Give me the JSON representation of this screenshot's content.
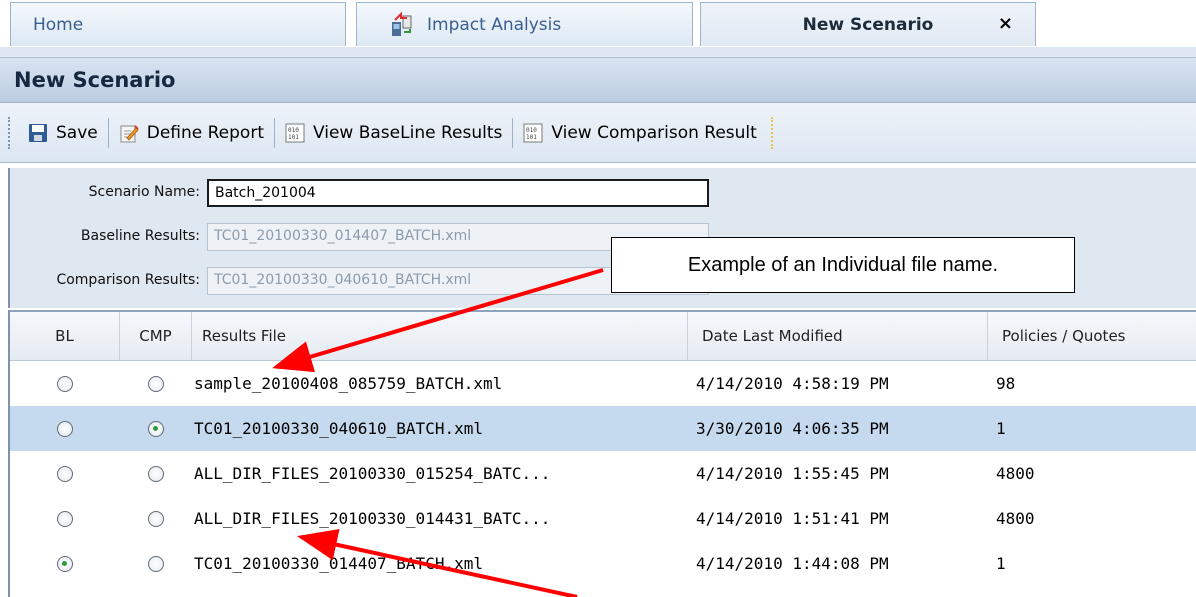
{
  "tabs": [
    {
      "label": "Home"
    },
    {
      "label": "Impact Analysis"
    },
    {
      "label": "New Scenario",
      "close": "×"
    }
  ],
  "panel": {
    "title": "New Scenario"
  },
  "toolbar": {
    "save": "Save",
    "define_report": "Define Report",
    "view_baseline": "View BaseLine Results",
    "view_comparison": "View Comparison Result"
  },
  "form": {
    "scenario_name_label": "Scenario Name:",
    "scenario_name_value": "Batch_201004",
    "baseline_label": "Baseline Results:",
    "baseline_value": "TC01_20100330_014407_BATCH.xml",
    "comparison_label": "Comparison Results:",
    "comparison_value": "TC01_20100330_040610_BATCH.xml"
  },
  "grid": {
    "columns": [
      "BL",
      "CMP",
      "Results File",
      "Date Last Modified",
      "Policies / Quotes"
    ],
    "rows": [
      {
        "bl": false,
        "cmp": false,
        "file": "sample_20100408_085759_BATCH.xml",
        "date": "4/14/2010 4:58:19 PM",
        "count": "98"
      },
      {
        "bl": false,
        "cmp": true,
        "file": "TC01_20100330_040610_BATCH.xml",
        "date": "3/30/2010 4:06:35 PM",
        "count": "1"
      },
      {
        "bl": false,
        "cmp": false,
        "file": "ALL_DIR_FILES_20100330_015254_BATC...",
        "date": "4/14/2010 1:55:45 PM",
        "count": "4800"
      },
      {
        "bl": false,
        "cmp": false,
        "file": "ALL_DIR_FILES_20100330_014431_BATC...",
        "date": "4/14/2010 1:51:41 PM",
        "count": "4800"
      },
      {
        "bl": true,
        "cmp": false,
        "file": "TC01_20100330_014407_BATCH.xml",
        "date": "4/14/2010 1:44:08 PM",
        "count": "1"
      }
    ],
    "selected_row": 1
  },
  "callout": {
    "text": "Example of an Individual file name."
  },
  "colors": {
    "accent": "#c5d9ef",
    "arrow": "#ff0000",
    "header": "#bccde2"
  }
}
